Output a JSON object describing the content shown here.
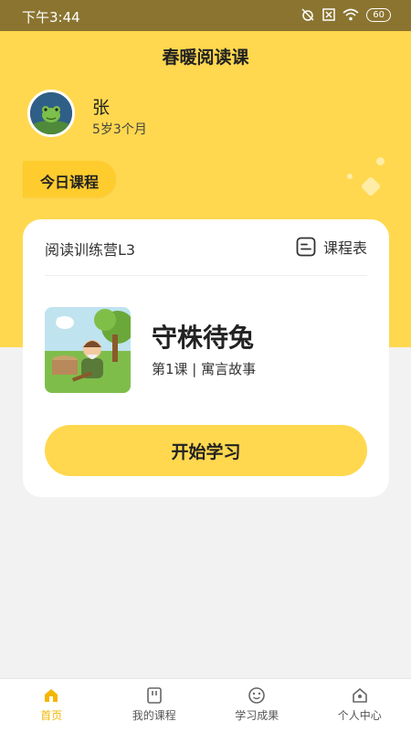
{
  "status_bar": {
    "time": "下午3:44",
    "battery": "60",
    "icons": [
      "alarm-off-icon",
      "sim-off-icon",
      "wifi-icon",
      "battery-icon"
    ]
  },
  "header": {
    "title": "春暖阅读课"
  },
  "profile": {
    "name": "张",
    "age": "5岁3个月"
  },
  "today_tab": {
    "label": "今日课程"
  },
  "course_card": {
    "camp_name": "阅读训练营L3",
    "schedule_label": "课程表",
    "lesson": {
      "title": "守株待兔",
      "subtitle": "第1课 | 寓言故事"
    },
    "start_label": "开始学习"
  },
  "tabbar": {
    "items": [
      {
        "label": "首页",
        "icon": "home-icon",
        "active": true
      },
      {
        "label": "我的课程",
        "icon": "course-book-icon",
        "active": false
      },
      {
        "label": "学习成果",
        "icon": "achievement-icon",
        "active": false
      },
      {
        "label": "个人中心",
        "icon": "profile-house-icon",
        "active": false
      }
    ]
  },
  "colors": {
    "accent_yellow": "#FFD84F",
    "tab_yellow": "#FFCC2E",
    "status_bar": "#8A7430",
    "active_tab": "#F3B700",
    "background": "#F2F2F2"
  }
}
